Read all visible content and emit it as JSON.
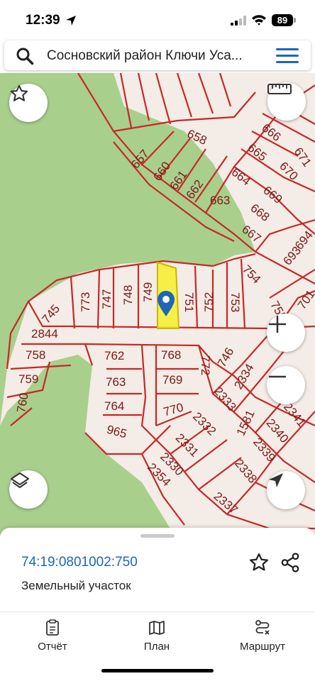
{
  "status_bar": {
    "time": "12:39",
    "battery": "89"
  },
  "search": {
    "text": "Сосновский район Ключи Уса..."
  },
  "map": {
    "parcel_labels": [
      "658",
      "657",
      "660",
      "661",
      "662",
      "663",
      "664",
      "665",
      "666",
      "671",
      "670",
      "669",
      "668",
      "667",
      "694",
      "693",
      "754",
      "701",
      "755",
      "745",
      "773",
      "747",
      "748",
      "749",
      "751",
      "752",
      "753",
      "2844",
      "758",
      "762",
      "768",
      "772",
      "746",
      "2334",
      "759",
      "763",
      "769",
      "2333",
      "760",
      "764",
      "770",
      "2332",
      "1581",
      "2341",
      "2340",
      "965",
      "2331",
      "2339",
      "2330",
      "2354",
      "2338",
      "2337"
    ],
    "selected_parcel": "750"
  },
  "parcel": {
    "cadastral_number": "74:19:0801002:750",
    "type": "Земельный участок"
  },
  "tabs": [
    {
      "label": "Отчёт",
      "icon": "report-icon"
    },
    {
      "label": "План",
      "icon": "map-plan-icon"
    },
    {
      "label": "Маршрут",
      "icon": "route-icon"
    }
  ],
  "colors": {
    "accent": "#1d66b8",
    "parcel_border": "#c62828",
    "forest": "#a9cf8c",
    "land": "#f4ece6",
    "selected": "#f6f02a"
  }
}
